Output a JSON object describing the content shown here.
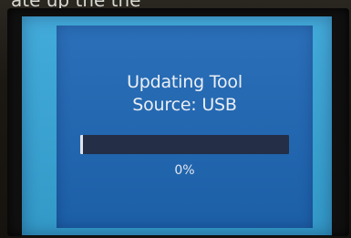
{
  "photo_caption": "ate up the the",
  "dialog": {
    "title": "Updating Tool",
    "source": "Source: USB",
    "progress_text": "0%",
    "progress_value": 0
  },
  "colors": {
    "screen_border": "#37a6d8",
    "panel": "#1e67b5",
    "progress_track": "#202b45",
    "progress_fill": "#e7eef8",
    "text": "#f1f5fb"
  }
}
